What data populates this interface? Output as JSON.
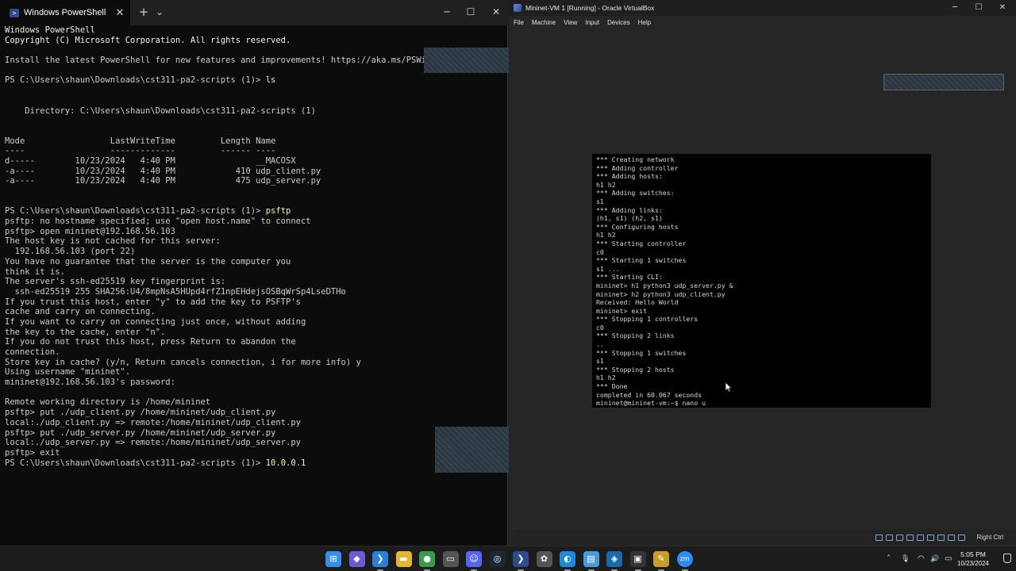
{
  "powershell": {
    "tab_title": "Windows PowerShell",
    "tab_close_glyph": "✕",
    "new_tab_glyph": "+",
    "dropdown_glyph": "⌄",
    "minimize_glyph": "─",
    "maximize_glyph": "☐",
    "close_glyph": "✕",
    "lines": [
      "Windows PowerShell",
      "Copyright (C) Microsoft Corporation. All rights reserved.",
      "",
      "Install the latest PowerShell for new features and improvements! https://aka.ms/PSWindows",
      "",
      "PS C:\\Users\\shaun\\Downloads\\cst311-pa2-scripts (1)> ls",
      "",
      "",
      "    Directory: C:\\Users\\shaun\\Downloads\\cst311-pa2-scripts (1)",
      "",
      "",
      "Mode                 LastWriteTime         Length Name",
      "----                 -------------         ------ ----",
      "d-----        10/23/2024   4:40 PM                __MACOSX",
      "-a----        10/23/2024   4:40 PM            410 udp_client.py",
      "-a----        10/23/2024   4:40 PM            475 udp_server.py",
      "",
      "",
      "PS C:\\Users\\shaun\\Downloads\\cst311-pa2-scripts (1)> psftp",
      "psftp: no hostname specified; use \"open host.name\" to connect",
      "psftp> open mininet@192.168.56.103",
      "The host key is not cached for this server:",
      "  192.168.56.103 (port 22)",
      "You have no guarantee that the server is the computer you",
      "think it is.",
      "The server's ssh-ed25519 key fingerprint is:",
      "  ssh-ed25519 255 SHA256:U4/8mpNsA5HUpd4rfZ1npEHdejsOSBqWrSp4LseDTHo",
      "If you trust this host, enter \"y\" to add the key to PSFTP's",
      "cache and carry on connecting.",
      "If you want to carry on connecting just once, without adding",
      "the key to the cache, enter \"n\".",
      "If you do not trust this host, press Return to abandon the",
      "connection.",
      "Store key in cache? (y/n, Return cancels connection, i for more info) y",
      "Using username \"mininet\".",
      "mininet@192.168.56.103's password:",
      "",
      "Remote working directory is /home/mininet",
      "psftp> put ./udp_client.py /home/mininet/udp_client.py",
      "local:./udp_client.py => remote:/home/mininet/udp_client.py",
      "psftp> put ./udp_server.py /home/mininet/udp_server.py",
      "local:./udp_server.py => remote:/home/mininet/udp_server.py",
      "psftp> exit",
      "PS C:\\Users\\shaun\\Downloads\\cst311-pa2-scripts (1)> 10.0.0.1"
    ]
  },
  "virtualbox": {
    "title": "Mininet-VM 1 [Running] - Oracle VirtualBox",
    "minimize_glyph": "─",
    "maximize_glyph": "☐",
    "close_glyph": "✕",
    "menus": [
      "File",
      "Machine",
      "View",
      "Input",
      "Devices",
      "Help"
    ],
    "console_lines": [
      "*** Creating network",
      "*** Adding controller",
      "*** Adding hosts:",
      "h1 h2",
      "*** Adding switches:",
      "s1",
      "*** Adding links:",
      "(h1, s1) (h2, s1)",
      "*** Configuring hosts",
      "h1 h2",
      "*** Starting controller",
      "c0",
      "*** Starting 1 switches",
      "s1 ...",
      "*** Starting CLI:",
      "mininet> h1 python3 udp_server.py &",
      "mininet> h2 python3 udp_client.py",
      "Received: Hello World",
      "mininet> exit",
      "*** Stopping 1 controllers",
      "c0",
      "*** Stopping 2 links",
      "..",
      "*** Stopping 1 switches",
      "s1",
      "*** Stopping 2 hosts",
      "h1 h2",
      "*** Done",
      "completed in 60.067 seconds",
      "mininet@mininet-vm:~$ nano u"
    ],
    "host_key_label": "Right Ctrl"
  },
  "taskbar": {
    "apps": [
      {
        "name": "start",
        "glyph": "⊞",
        "color": "#3a8ee6"
      },
      {
        "name": "copilot",
        "glyph": "◆",
        "color": "#6b5bd6"
      },
      {
        "name": "vscode",
        "glyph": "❯",
        "color": "#2b7fd4"
      },
      {
        "name": "file-explorer",
        "glyph": "▬",
        "color": "#e8b531"
      },
      {
        "name": "chrome",
        "glyph": "●",
        "color": "#3a9c4a"
      },
      {
        "name": "task-view",
        "glyph": "▭",
        "color": "#555555"
      },
      {
        "name": "discord",
        "glyph": "☺",
        "color": "#5865f2"
      },
      {
        "name": "steam",
        "glyph": "◎",
        "color": "#1b2838"
      },
      {
        "name": "powershell",
        "glyph": "❯",
        "color": "#2d4c8c"
      },
      {
        "name": "settings",
        "glyph": "✿",
        "color": "#555555"
      },
      {
        "name": "edge",
        "glyph": "◐",
        "color": "#1b8adb"
      },
      {
        "name": "notepad",
        "glyph": "▤",
        "color": "#4a9ad8"
      },
      {
        "name": "virtualbox",
        "glyph": "◈",
        "color": "#1a6aa8"
      },
      {
        "name": "terminal",
        "glyph": "▣",
        "color": "#333333"
      },
      {
        "name": "paint",
        "glyph": "✎",
        "color": "#c5a028"
      },
      {
        "name": "zoom",
        "glyph": "zm",
        "color": "#2d8cff"
      }
    ],
    "tray": {
      "chevron_glyph": "˄",
      "mic_glyph": "🎙",
      "wifi_glyph": "◠",
      "speaker_glyph": "🔊",
      "battery_glyph": "▭"
    },
    "clock_time": "5:05 PM",
    "clock_date": "10/23/2024"
  }
}
